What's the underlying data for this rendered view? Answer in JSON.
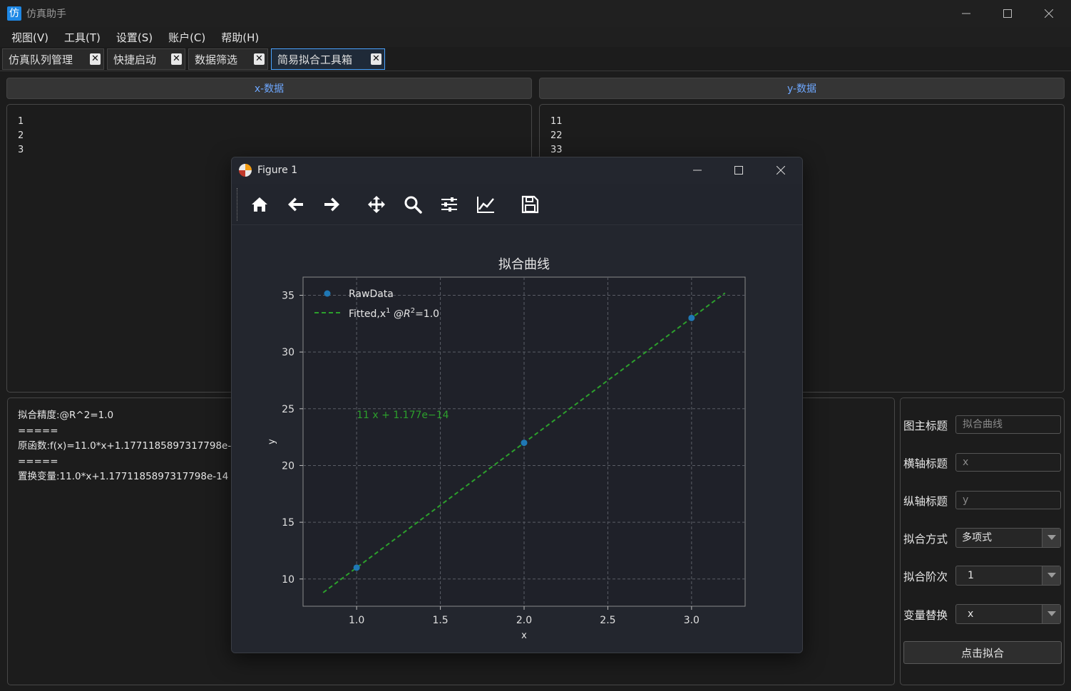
{
  "app": {
    "title": "仿真助手",
    "icon_char": "仿"
  },
  "menu": [
    "视图(V)",
    "工具(T)",
    "设置(S)",
    "账户(C)",
    "帮助(H)"
  ],
  "tabs": [
    {
      "label": "仿真队列管理",
      "active": false
    },
    {
      "label": "快捷启动",
      "active": false
    },
    {
      "label": "数据筛选",
      "active": false
    },
    {
      "label": "简易拟合工具箱",
      "active": true
    }
  ],
  "x_panel": {
    "header": "x-数据",
    "values": [
      "1",
      "2",
      "3"
    ]
  },
  "y_panel": {
    "header": "y-数据",
    "values": [
      "11",
      "22",
      "33"
    ]
  },
  "result_lines": [
    "拟合精度:@R^2=1.0",
    "=====",
    "原函数:f(x)=11.0*x+1.1771185897317798e-14",
    "=====",
    "置换变量:11.0*x+1.1771185897317798e-14"
  ],
  "settings": {
    "title_label": "图主标题",
    "title_value": "拟合曲线",
    "xlabel_label": "横轴标题",
    "xlabel_value": "x",
    "ylabel_label": "纵轴标题",
    "ylabel_value": "y",
    "method_label": "拟合方式",
    "method_value": "多项式",
    "order_label": "拟合阶次",
    "order_value": "1",
    "subst_label": "变量替换",
    "subst_value": "x",
    "fit_button": "点击拟合"
  },
  "figure": {
    "window_title": "Figure 1",
    "chart_data": {
      "type": "line",
      "title": "拟合曲线",
      "xlabel": "x",
      "ylabel": "y",
      "xlim": [
        0.68,
        3.32
      ],
      "ylim": [
        7.6,
        36.6
      ],
      "xticks": [
        1.0,
        1.5,
        2.0,
        2.5,
        3.0
      ],
      "xtick_labels": [
        "1.0",
        "1.5",
        "2.0",
        "2.5",
        "3.0"
      ],
      "yticks": [
        10,
        15,
        20,
        25,
        30,
        35
      ],
      "yticks_labels": [
        "10",
        "15",
        "20",
        "25",
        "30",
        "35"
      ],
      "grid": true,
      "legend_position": "top-left",
      "series": [
        {
          "name": "RawData",
          "kind": "scatter",
          "color": "#1f77b4",
          "x": [
            1,
            2,
            3
          ],
          "y": [
            11,
            22,
            33
          ]
        },
        {
          "name": "Fitted,x",
          "name_sup": "1",
          "name_suffix": "  @R",
          "name_sup2": "2",
          "name_end": "=1.0",
          "kind": "dashed-line",
          "color": "#2ca02c",
          "x": [
            0.8,
            3.2
          ],
          "y": [
            8.8,
            35.2
          ]
        }
      ],
      "annotation": {
        "text": "11 x + 1.177e−14",
        "x": 1.0,
        "y": 24.5,
        "color": "#2ca02c"
      }
    }
  }
}
